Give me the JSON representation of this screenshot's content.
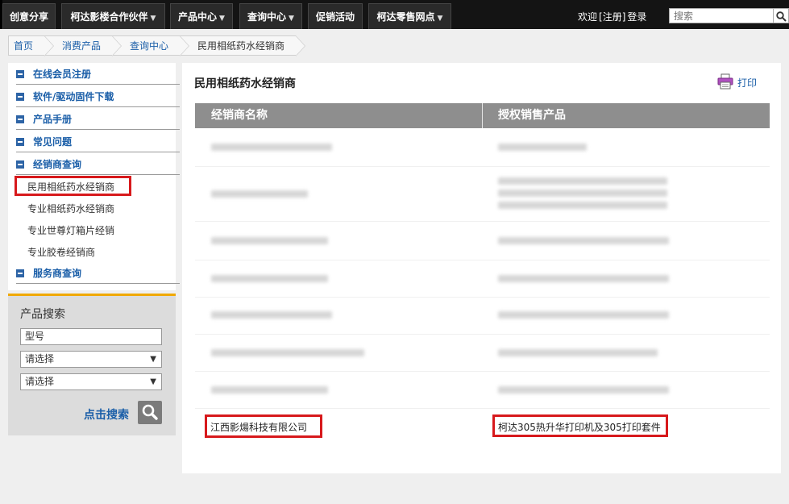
{
  "nav": {
    "items": [
      {
        "label": "创意分享",
        "caret": false
      },
      {
        "label": "柯达影楼合作伙伴",
        "caret": true
      },
      {
        "label": "产品中心",
        "caret": true
      },
      {
        "label": "查询中心",
        "caret": true
      },
      {
        "label": "促销活动",
        "caret": false
      },
      {
        "label": "柯达零售网点",
        "caret": true
      }
    ],
    "welcome": "欢迎",
    "register": "[注册]",
    "login": "登录",
    "search_placeholder": "搜索"
  },
  "breadcrumb": [
    "首页",
    "消费产品",
    "查询中心",
    "民用相纸药水经销商"
  ],
  "sidebar": {
    "categories": [
      "在线会员注册",
      "软件/驱动固件下载",
      "产品手册",
      "常见问题",
      "经销商查询",
      "服务商查询"
    ],
    "sub_items": [
      "民用相纸药水经销商",
      "专业相纸药水经销商",
      "专业世尊灯箱片经销",
      "专业胶卷经销商"
    ]
  },
  "product_search": {
    "title": "产品搜索",
    "model_value": "型号",
    "select1_value": "请选择",
    "select2_value": "请选择",
    "button_label": "点击搜索"
  },
  "main": {
    "title": "民用相纸药水经销商",
    "print_label": "打印",
    "columns": [
      "经销商名称",
      "授权销售产品"
    ],
    "last_row": {
      "dealer": "江西影煬科技有限公司",
      "product": "柯达305热升华打印机及305打印套件"
    }
  },
  "colors": {
    "accent_blue": "#1a5ea8",
    "highlight_red": "#d7191c",
    "search_panel_border": "#f0a800"
  }
}
